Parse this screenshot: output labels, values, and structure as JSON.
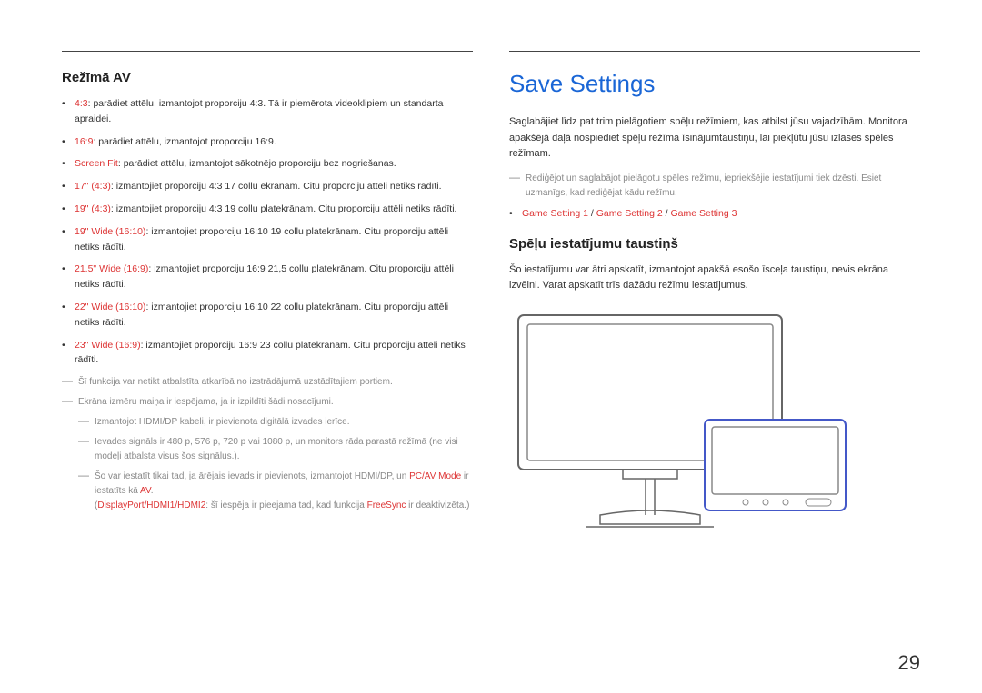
{
  "left": {
    "subheading": "Režīmā AV",
    "items": [
      {
        "label": "4:3",
        "text": ": parādiet attēlu, izmantojot proporciju 4:3. Tā ir piemērota videoklipiem un standarta apraidei."
      },
      {
        "label": "16:9",
        "text": ": parādiet attēlu, izmantojot proporciju 16:9."
      },
      {
        "label": "Screen Fit",
        "text": ": parādiet attēlu, izmantojot sākotnējo proporciju bez nogriešanas."
      },
      {
        "label": "17\" (4:3)",
        "text": ": izmantojiet proporciju 4:3 17 collu ekrānam. Citu proporciju attēli netiks rādīti."
      },
      {
        "label": "19\" (4:3)",
        "text": ": izmantojiet proporciju 4:3 19 collu platekrānam. Citu proporciju attēli netiks rādīti."
      },
      {
        "label": "19\" Wide (16:10)",
        "text": ": izmantojiet proporciju 16:10 19 collu platekrānam. Citu proporciju attēli netiks rādīti."
      },
      {
        "label": "21.5\" Wide (16:9)",
        "text": ": izmantojiet proporciju 16:9 21,5 collu platekrānam. Citu proporciju attēli netiks rādīti."
      },
      {
        "label": "22\" Wide (16:10)",
        "text": ": izmantojiet proporciju 16:10 22 collu platekrānam. Citu proporciju attēli netiks rādīti."
      },
      {
        "label": "23\" Wide (16:9)",
        "text": ": izmantojiet proporciju 16:9 23 collu platekrānam. Citu proporciju attēli netiks rādīti."
      }
    ],
    "notes": {
      "n1": "Šī funkcija var netikt atbalstīta atkarībā no izstrādājumā uzstādītajiem portiem.",
      "n2": "Ekrāna izmēru maiņa ir iespējama, ja ir izpildīti šādi nosacījumi.",
      "n2a": "Izmantojot HDMI/DP kabeli, ir pievienota digitālā izvades ierīce.",
      "n2b_pre": "Ievades signāls ir 480 p, 576 p, 720 p vai 1080 p, un monitors rāda parastā režīmā (ne visi modeļi atbalsta visus šos signālus.).",
      "n2c_pre": "Šo var iestatīt tikai tad, ja ārējais ievads ir pievienots, izmantojot HDMI/DP, un ",
      "n2c_red1": "PC/AV Mode",
      "n2c_mid": " ir iestatīts kā ",
      "n2c_red2": "AV",
      "n2c_dot": ".",
      "n2c_extra_pre": "(",
      "n2c_extra_red": "DisplayPort/HDMI1/HDMI2",
      "n2c_extra_mid": ": šī iespēja ir pieejama tad, kad funkcija ",
      "n2c_extra_red2": "FreeSync",
      "n2c_extra_end": " ir deaktivizēta.)"
    }
  },
  "right": {
    "title": "Save Settings",
    "para1": "Saglabājiet līdz pat trim pielāgotiem spēļu režīmiem, kas atbilst jūsu vajadzībām. Monitora apakšējā daļā nospiediet spēļu režīma īsinājumtaustiņu, lai piekļūtu jūsu izlases spēles režīmam.",
    "note1": "Rediģējot un saglabājot pielāgotu spēles režīmu, iepriekšējie iestatījumi tiek dzēsti. Esiet uzmanīgs, kad rediģējat kādu režīmu.",
    "bullet_r1": "Game Setting 1",
    "bullet_sep": " / ",
    "bullet_r2": "Game Setting 2",
    "bullet_r3": "Game Setting 3",
    "subheading2": "Spēļu iestatījumu taustiņš",
    "para2": "Šo iestatījumu var ātri apskatīt, izmantojot apakšā esošo īsceļa taustiņu, nevis ekrāna izvēlni. Varat apskatīt trīs dažādu režīmu iestatījumus."
  },
  "page_number": "29"
}
